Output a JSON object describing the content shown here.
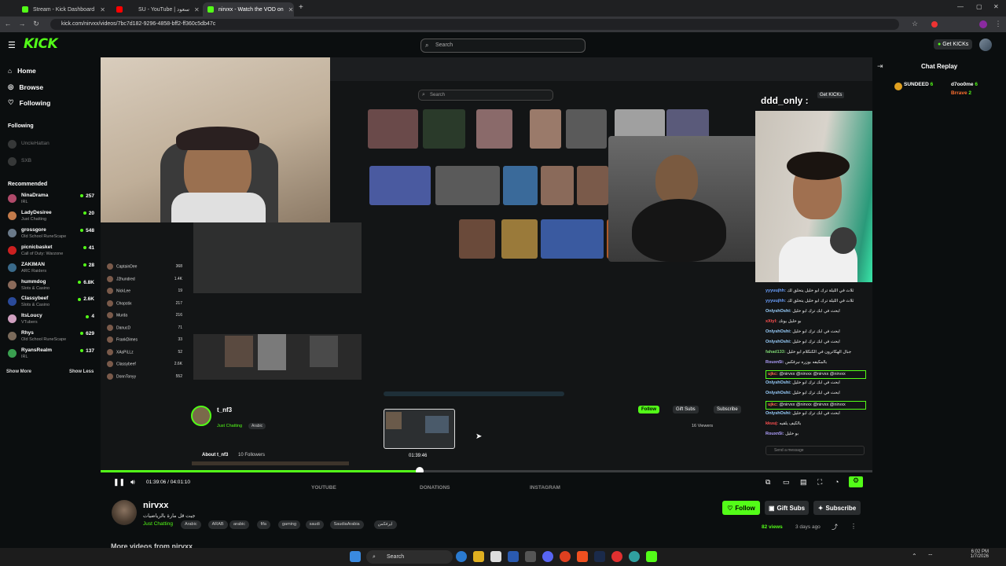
{
  "browser": {
    "tabs": [
      {
        "title": "Stream - Kick Dashboard",
        "color": "#53fc18"
      },
      {
        "title": "",
        "color": "#ff0000"
      },
      {
        "title": "SU - YouTube | سعود",
        "color": "#ff0000"
      },
      {
        "title": "nirvxx - Watch the VOD on",
        "color": "#53fc18"
      }
    ],
    "new_tab": "+",
    "url": "kick.com/nirvxx/videos/7bc7d182-9296-4858-bff2-ff360c5db47c"
  },
  "header": {
    "logo": "KICK",
    "search_placeholder": "Search",
    "get_kicks": "Get KICKs"
  },
  "sidebar": {
    "nav": [
      {
        "label": "Home",
        "icon": "home-icon"
      },
      {
        "label": "Browse",
        "icon": "compass-icon"
      },
      {
        "label": "Following",
        "icon": "heart-icon"
      }
    ],
    "following_title": "Following",
    "following": [
      {
        "name": "UncleHattan"
      },
      {
        "name": "SXB"
      }
    ],
    "recommended_title": "Recommended",
    "recommended": [
      {
        "name": "NinaDrama",
        "category": "IRL",
        "viewers": "257",
        "color": "#b04a6a"
      },
      {
        "name": "LadyDesiree",
        "category": "Just Chatting",
        "viewers": "20",
        "color": "#c27a4a"
      },
      {
        "name": "grossgore",
        "category": "Old School RuneScape",
        "viewers": "548",
        "color": "#6a7a8a"
      },
      {
        "name": "picnicbasket",
        "category": "Call of Duty: Warzone",
        "viewers": "41",
        "color": "#cc2020"
      },
      {
        "name": "ZAKIMAN",
        "category": "ARC Raiders",
        "viewers": "28",
        "color": "#3a6a8a"
      },
      {
        "name": "hummdog",
        "category": "Slots & Casino",
        "viewers": "6.8K",
        "color": "#8a6a5a"
      },
      {
        "name": "Classybeef",
        "category": "Slots & Casino",
        "viewers": "2.6K",
        "color": "#2a4a9a"
      },
      {
        "name": "ItsLoucy",
        "category": "VTubers",
        "viewers": "4",
        "color": "#d0a0c0"
      },
      {
        "name": "Rhys",
        "category": "Old School RuneScape",
        "viewers": "629",
        "color": "#7a6a5a"
      },
      {
        "name": "RyansRealm",
        "category": "IRL",
        "viewers": "137",
        "color": "#3aa050"
      }
    ],
    "show_more": "Show More",
    "show_less": "Show Less"
  },
  "video": {
    "inner_search": "Search",
    "inner_get_kicks": "Get KICKs",
    "inner_channel": "t_nf3",
    "inner_category": "Just Chatting",
    "inner_tag": "Arabic",
    "inner_follow": "Follow",
    "inner_gift": "Gift Subs",
    "inner_subscribe": "Subscribe",
    "inner_viewers": "16 Viewers",
    "inner_about": "About t_nf3",
    "inner_followers": "10 Followers",
    "overlay_username": "ddd_only :",
    "preview_time": "01:39:46",
    "progress": 0.413,
    "inner_rec": [
      {
        "name": "CaptainDee",
        "v": "368"
      },
      {
        "name": "J2hundred",
        "v": "1.4K"
      },
      {
        "name": "NickLee",
        "v": "19"
      },
      {
        "name": "Chopstix",
        "v": "217"
      },
      {
        "name": "Murda",
        "v": "216"
      },
      {
        "name": "DanucD",
        "v": "71"
      },
      {
        "name": "FrankDimes",
        "v": "33"
      },
      {
        "name": "XAsPiLLz",
        "v": "52"
      },
      {
        "name": "Classybeef",
        "v": "2.6K"
      },
      {
        "name": "DonnTonyy",
        "v": "552"
      }
    ]
  },
  "player": {
    "time": "01:39:06 / 04:01:10",
    "tabs": [
      "YOUTUBE",
      "DONATIONS",
      "INSTAGRAM"
    ]
  },
  "chat": {
    "title": "Chat Replay",
    "top_users": [
      {
        "name": "SUNDEED",
        "count": "6"
      },
      {
        "name": "d7oo0me",
        "count": "6"
      },
      {
        "name": "Brrave",
        "count": "2"
      }
    ],
    "messages": [
      {
        "user": "yyyuujhh:",
        "text": "ثلاث في الليلة ترك ابو خليل يتحلق لك",
        "color": "#6aa0ff"
      },
      {
        "user": "yyyuujhh:",
        "text": "ثلاث في الليلة ترك ابو خليل يتحلق لك",
        "color": "#6aa0ff"
      },
      {
        "user": "OnlyshOshi:",
        "text": "ابحث في ابك ترك ابو خليل",
        "color": "#9ad0ff"
      },
      {
        "user": "xXtyl:",
        "text": "بو خليل يونك",
        "color": "#ff5050"
      },
      {
        "user": "OnlyshOshi:",
        "text": "ابحث في ابك ترك ابو خليل",
        "color": "#9ad0ff"
      },
      {
        "user": "OnlyshOshi:",
        "text": "ابحث في ابك ترك ابو خليل",
        "color": "#9ad0ff"
      },
      {
        "user": "fahad133:",
        "text": "جبال الهكاترون في الكتكلام ابو خليل",
        "color": "#7ad070"
      },
      {
        "user": "Rouxn5i:",
        "text": "بالمكيفه بوزره نيرفكس",
        "color": "#b0a0ff"
      },
      {
        "user": "ujkc:",
        "text": "@nirvxx @nirvxx @nirvxx @nirvxx",
        "color": "#ff7050",
        "highlight": true
      },
      {
        "user": "OnlyshOshi:",
        "text": "ابحث في ابك ترك ابو خليل",
        "color": "#9ad0ff"
      },
      {
        "user": "OnlyshOshi:",
        "text": "ابحث في ابك ترك ابو خليل",
        "color": "#9ad0ff"
      },
      {
        "user": "ujkc:",
        "text": "@nirvxx @nirvxx @nirvxx @nirvxx",
        "color": "#ff7050",
        "highlight": true
      },
      {
        "user": "OnlyshOshi:",
        "text": "ابحث في ابك ترك ابو خليل",
        "color": "#9ad0ff"
      },
      {
        "user": "kkuuj:",
        "text": "بالكيف يلقيه",
        "color": "#ff5050"
      },
      {
        "user": "Rouxn5i:",
        "text": "بو خليل",
        "color": "#b0a0ff"
      }
    ],
    "send_placeholder": "Send a message"
  },
  "below": {
    "channel_name": "nirvxx",
    "title": "جيت قل مارة بالرياضيات",
    "category": "Just Chatting",
    "tags": [
      "Arabic",
      "ARAB",
      "arabic",
      "fifa",
      "gaming",
      "saudi",
      "SaudiaArabia",
      "ايرفكس"
    ],
    "follow": "Follow",
    "gift": "Gift Subs",
    "subscribe": "Subscribe",
    "views": "82 views",
    "date": "3 days ago",
    "more_videos": "More videos from nirvxx"
  },
  "taskbar": {
    "search": "Search",
    "time": "6:02 PM",
    "date": "1/7/2026"
  }
}
